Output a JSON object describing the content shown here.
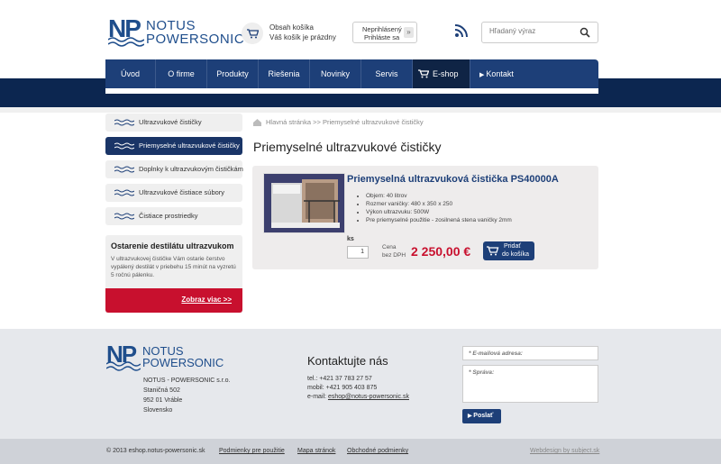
{
  "brand": {
    "line1": "NOTUS",
    "line2": "POWERSONIC",
    "mark": "NP"
  },
  "cart": {
    "title": "Obsah košíka",
    "status": "Váš košík je prázdny"
  },
  "login": {
    "line1": "Neprihlásený",
    "line2": "Prihláste sa"
  },
  "search": {
    "placeholder": "Hľadaný výraz"
  },
  "nav": [
    {
      "label": "Úvod"
    },
    {
      "label": "O firme"
    },
    {
      "label": "Produkty"
    },
    {
      "label": "Riešenia"
    },
    {
      "label": "Novinky"
    },
    {
      "label": "Servis"
    },
    {
      "label": "E-shop"
    },
    {
      "label": "Kontakt"
    }
  ],
  "sidebar": {
    "items": [
      {
        "label": "Ultrazvukové čističky",
        "active": false
      },
      {
        "label": "Priemyselné ultrazvukové čističky",
        "active": true
      },
      {
        "label": "Doplnky k ultrazvukovým čističkám",
        "active": false
      },
      {
        "label": "Ultrazvukové čistiace súbory",
        "active": false
      },
      {
        "label": "Čistiace prostriedky",
        "active": false
      }
    ],
    "promo": {
      "title": "Ostarenie destilátu ultrazvukom",
      "text": "V ultrazvukovej čističke Vám ostarie čerstvo vypálený destilát v priebehu 15 minút na vyzretú 5 ročnú pálenku.",
      "link": "Zobraz viac >>"
    }
  },
  "breadcrumb": {
    "home": "Hlavná stránka",
    "current": ">> Priemyselné ultrazvukové čističky"
  },
  "page_title": "Priemyselné ultrazvukové čističky",
  "product": {
    "name": "Priemyselná ultrazvuková čistička PS40000A",
    "specs": [
      "Objem: 40 litrov",
      "Rozmer vaničky: 480 x 350 x 250",
      "Výkon ultrazvuku: 500W",
      "Pre priemyselné použitie - zosilnená stena vaničky 2mm"
    ],
    "qty_label": "ks",
    "qty": "1",
    "price_label_1": "Cena",
    "price_label_2": "bez DPH",
    "price": "2 250,00 €",
    "add_line1": "Pridať",
    "add_line2": "do košíka"
  },
  "footer": {
    "company": [
      "NOTUS - POWERSONIC s.r.o.",
      "Staničná 502",
      "952 01 Vráble",
      "Slovensko"
    ],
    "contact_title": "Kontaktujte nás",
    "tel": "tel.: +421 37 783 27 57",
    "mobil": "mobil: +421 905 403 875",
    "email_label": "e-mail:",
    "email": "eshop@notus-powersonic.sk",
    "form_email": "* E-mailová adresa:",
    "form_message": "* Správa:",
    "send": "Poslať"
  },
  "bottom": {
    "copyright": "© 2013 eshop.notus-powersonic.sk",
    "links": [
      "Podmienky pre použitie",
      "Mapa stránok",
      "Obchodné podmienky"
    ],
    "webdesign": "Webdesign by subject.sk"
  },
  "colors": {
    "navy": "#1d3f78",
    "dark_band": "#0c2650",
    "red": "#c8102e"
  }
}
